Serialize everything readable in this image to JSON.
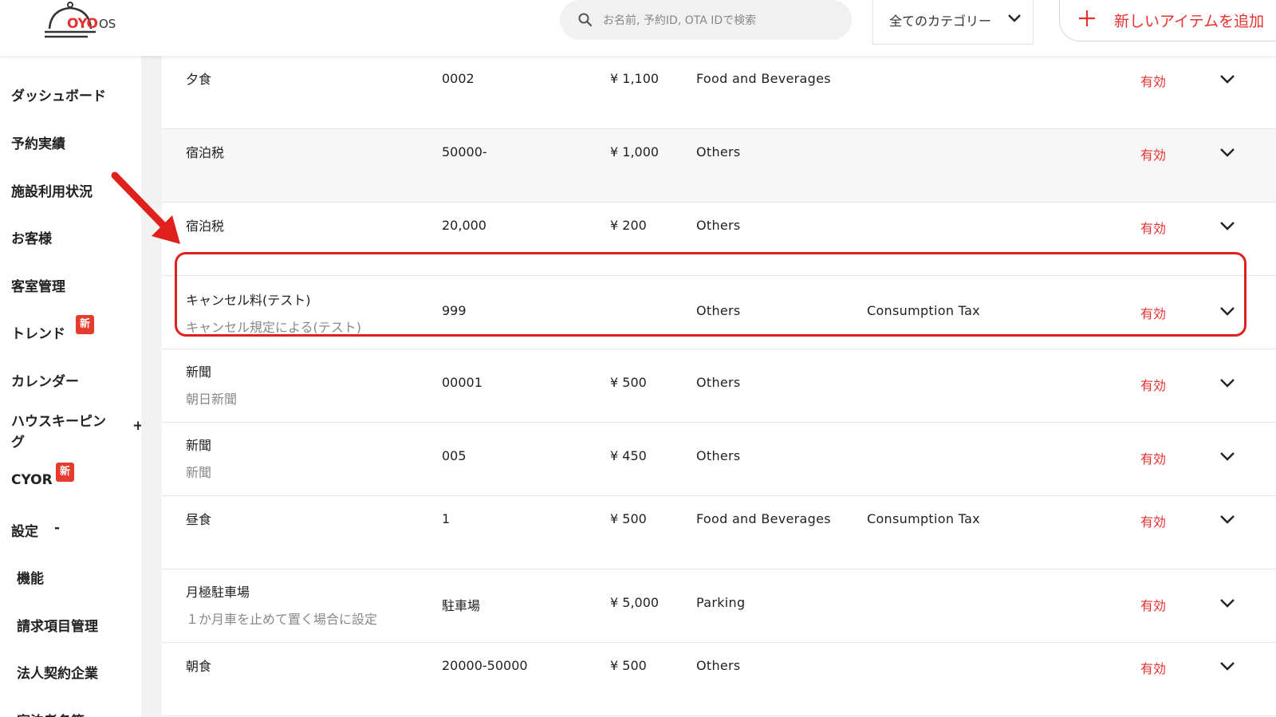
{
  "header": {
    "logo_text": "OYO",
    "logo_os": "OS",
    "search_placeholder": "お名前, 予約ID, OTA IDで検索",
    "category_label": "全てのカテゴリー",
    "add_button_label": "新しいアイテムを追加"
  },
  "sidebar": {
    "items": [
      {
        "label": "ダッシュボード"
      },
      {
        "label": "予約実績"
      },
      {
        "label": "施設利用状況"
      },
      {
        "label": "お客様"
      },
      {
        "label": "客室管理"
      },
      {
        "label": "トレンド",
        "badge": "新"
      },
      {
        "label": "カレンダー"
      },
      {
        "label": "ハウスキーピン",
        "label2": "グ",
        "toggle": "+"
      },
      {
        "label": "CYOR",
        "badge": "新"
      },
      {
        "label": "設定",
        "toggle": "-"
      },
      {
        "label": "機能"
      },
      {
        "label": "請求項目管理"
      },
      {
        "label": "法人契約企業"
      },
      {
        "label": "宿泊者名簿"
      }
    ]
  },
  "rows": [
    {
      "name": "夕食",
      "desc": "",
      "code": "0002",
      "price": "¥ 1,100",
      "category": "Food and Beverages",
      "tax": "",
      "status": "有効"
    },
    {
      "name": "宿泊税",
      "desc": "",
      "code": "50000-",
      "price": "¥ 1,000",
      "category": "Others",
      "tax": "",
      "status": "有効"
    },
    {
      "name": "宿泊税",
      "desc": "",
      "code": "20,000",
      "price": "¥ 200",
      "category": "Others",
      "tax": "",
      "status": "有効"
    },
    {
      "name": "キャンセル料(テスト)",
      "desc": "キャンセル規定による(テスト)",
      "code": "999",
      "price": "",
      "category": "Others",
      "tax": "Consumption Tax",
      "status": "有効"
    },
    {
      "name": "新聞",
      "desc": "朝日新聞",
      "code": "00001",
      "price": "¥ 500",
      "category": "Others",
      "tax": "",
      "status": "有効"
    },
    {
      "name": "新聞",
      "desc": "新聞",
      "code": "005",
      "price": "¥ 450",
      "category": "Others",
      "tax": "",
      "status": "有効"
    },
    {
      "name": "昼食",
      "desc": "",
      "code": "1",
      "price": "¥ 500",
      "category": "Food and Beverages",
      "tax": "Consumption Tax",
      "status": "有効"
    },
    {
      "name": "月極駐車場",
      "desc": "１か月車を止めて置く場合に設定",
      "code": "駐車場",
      "price": "¥ 5,000",
      "category": "Parking",
      "tax": "",
      "status": "有効"
    },
    {
      "name": "朝食",
      "desc": "",
      "code": "20000-50000",
      "price": "¥ 500",
      "category": "Others",
      "tax": "",
      "status": "有効"
    }
  ],
  "colors": {
    "accent": "#e8302f",
    "highlight": "#e0201c"
  },
  "icons": {
    "search": "search-icon",
    "chevron": "chevron-down-icon",
    "plus": "plus-icon",
    "logo": "cloche-logo-icon"
  }
}
